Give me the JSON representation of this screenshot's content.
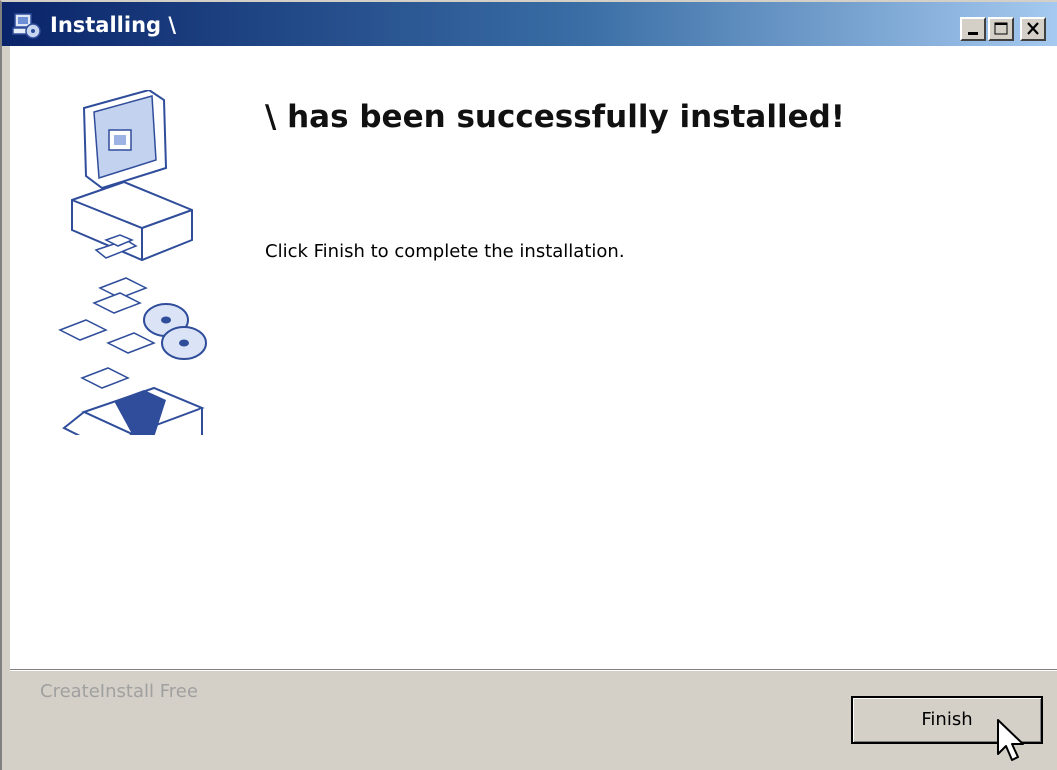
{
  "window": {
    "title": "Installing \\",
    "icon": "installer-icon",
    "controls": [
      "minimize-icon",
      "maximize-icon",
      "close-icon"
    ]
  },
  "content": {
    "heading": "\\ has been successfully installed!",
    "message": "Click Finish to complete the installation.",
    "illustration": "computer-disks-box-illustration"
  },
  "footer": {
    "brand": "CreateInstall Free",
    "finish_label": "Finish"
  },
  "colors": {
    "titlebar_start": "#0a246a",
    "titlebar_end": "#a6caf0",
    "face": "#d4d0c8",
    "content_bg": "#ffffff",
    "illustration_blue": "#2f4d9b"
  }
}
